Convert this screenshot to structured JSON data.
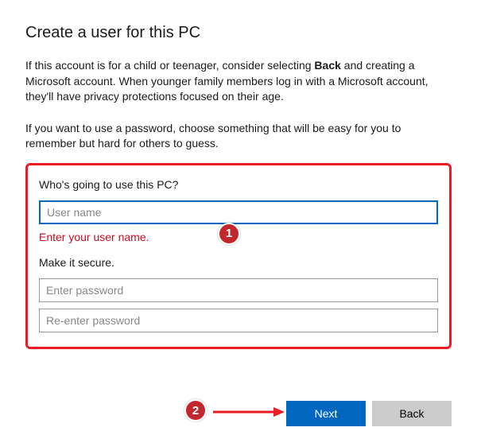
{
  "title": "Create a user for this PC",
  "intro_prefix": "If this account is for a child or teenager, consider selecting ",
  "intro_bold": "Back",
  "intro_suffix": " and creating a Microsoft account. When younger family members log in with a Microsoft account, they'll have privacy protections focused on their age.",
  "hint": "If you want to use a password, choose something that will be easy for you to remember but hard for others to guess.",
  "form": {
    "who_label": "Who's going to use this PC?",
    "username_placeholder": "User name",
    "username_value": "",
    "error": "Enter your user name.",
    "secure_label": "Make it secure.",
    "password_placeholder": "Enter password",
    "password_value": "",
    "confirm_placeholder": "Re-enter password",
    "confirm_value": ""
  },
  "annotations": {
    "badge1": "1",
    "badge2": "2"
  },
  "buttons": {
    "next": "Next",
    "back": "Back"
  },
  "colors": {
    "accent": "#0067c0",
    "error": "#c50f1f",
    "callout": "#c1272d",
    "outline": "#ed1c24"
  }
}
